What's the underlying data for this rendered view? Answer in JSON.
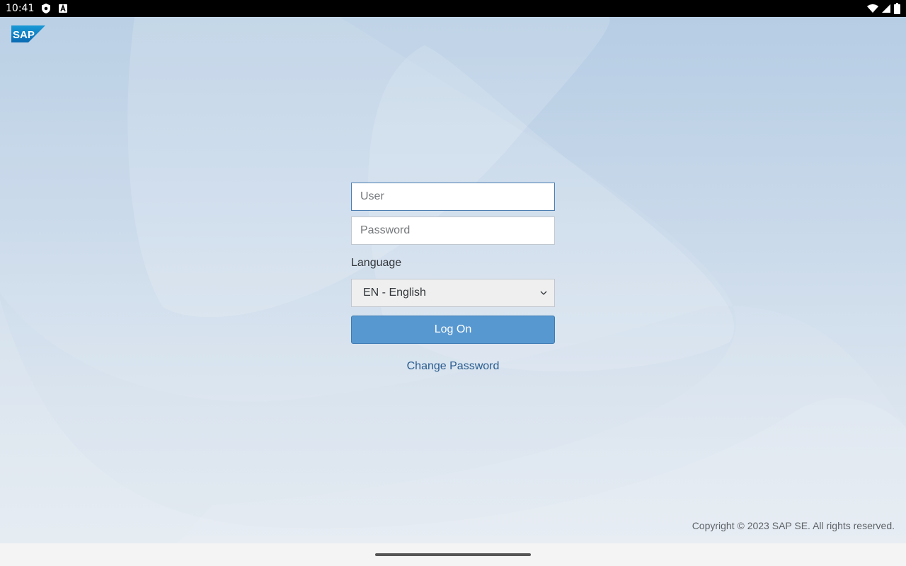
{
  "status_bar": {
    "time": "10:41",
    "left_icons": [
      "shield-icon",
      "font-a-icon"
    ],
    "right_icons": [
      "wifi-icon",
      "signal-icon",
      "battery-icon"
    ]
  },
  "app": {
    "logo_text": "SAP",
    "login": {
      "user_placeholder": "User",
      "password_placeholder": "Password",
      "language_label": "Language",
      "language_selected": "EN - English",
      "logon_label": "Log On",
      "change_password_label": "Change Password"
    },
    "copyright": "Copyright © 2023 SAP SE. All rights reserved.",
    "colors": {
      "primary_button": "#5898d0",
      "link": "#2a5c8f",
      "background_top": "#b6cde4",
      "background_bottom": "#e3eaf1"
    }
  }
}
